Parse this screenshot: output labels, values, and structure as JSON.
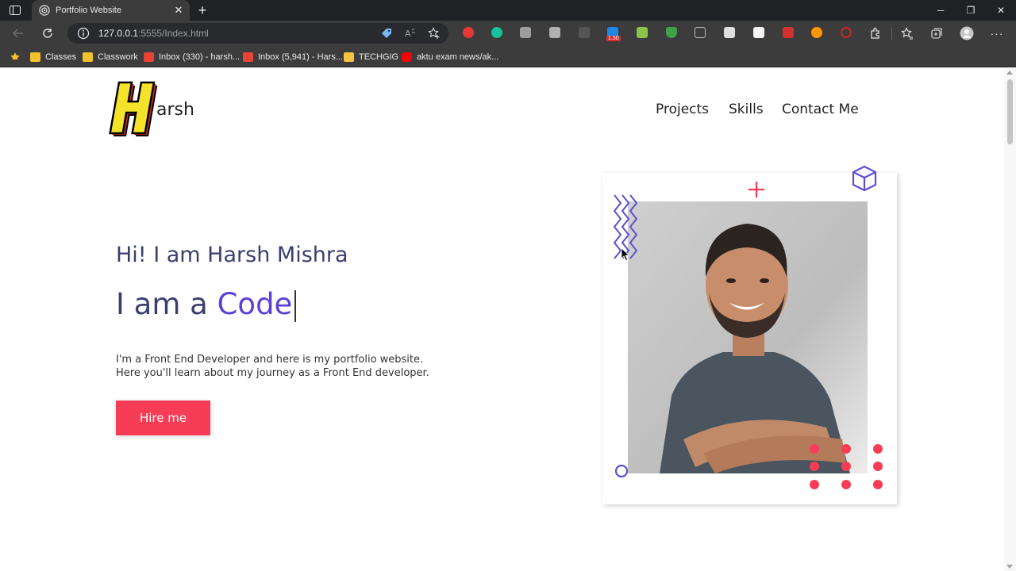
{
  "browser": {
    "tab_title": "Portfolio Website",
    "url_host": "127.0.0.1",
    "url_rest": ":5555/Index.html",
    "extension_badge": "1.50"
  },
  "bookmarks": [
    {
      "label": "Classes",
      "color": "#f2c12e"
    },
    {
      "label": "Classwork",
      "color": "#f2c12e"
    },
    {
      "label": "Inbox (330) - harsh...",
      "color": "#ea4335"
    },
    {
      "label": "Inbox (5,941) - Hars...",
      "color": "#ea4335"
    },
    {
      "label": "TECHGIG",
      "color": "#f5c542"
    },
    {
      "label": "aktu exam news/ak...",
      "color": "#ff0000"
    }
  ],
  "site": {
    "logo_letter": "H",
    "logo_text": "arsh",
    "nav": [
      "Projects",
      "Skills",
      "Contact Me"
    ],
    "greeting": "Hi! I am Harsh Mishra",
    "role_prefix": "I am a ",
    "role_typed": "Code",
    "description_line1": "I'm a Front End Developer and here is my portfolio website.",
    "description_line2": "Here you'll learn about my journey as a Front End developer.",
    "hire_label": "Hire me"
  },
  "colors": {
    "accent_red": "#f73d55",
    "accent_purple": "#5b3fd8",
    "heading_navy": "#3a3f6e"
  }
}
